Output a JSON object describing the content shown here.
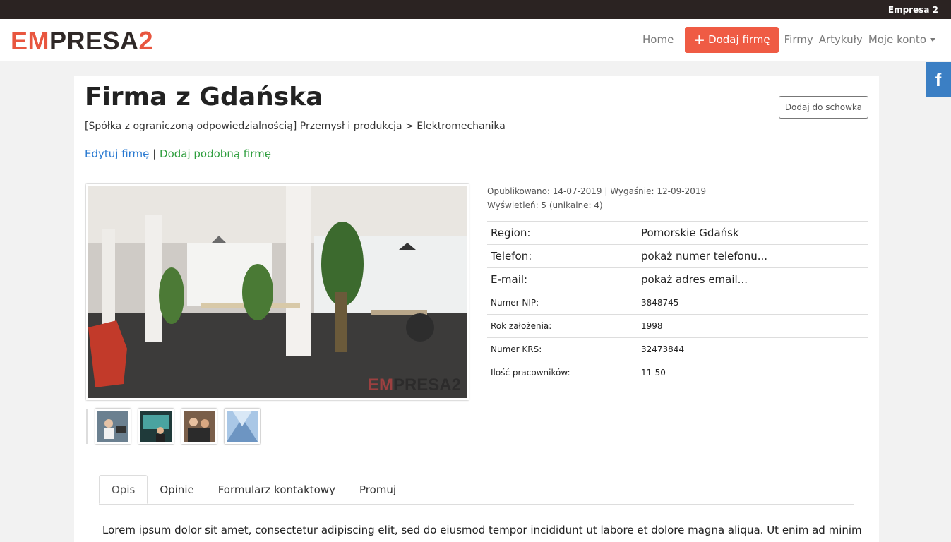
{
  "topbar": {
    "site_name": "Empresa 2"
  },
  "logo": {
    "part1": "EM",
    "part2": "PRESA",
    "part3": "2"
  },
  "nav": {
    "home": "Home",
    "add_company": "Dodaj firmę",
    "companies": "Firmy",
    "articles": "Artykuły",
    "account": "Moje konto"
  },
  "social": {
    "facebook": "f"
  },
  "company": {
    "title": "Firma z Gdańska",
    "save_button": "Dodaj do schowka",
    "subtitle": "[Spółka z ograniczoną odpowiedzialnością] Przemysł i produkcja > Elektromechanika",
    "edit_link": "Edytuj firmę",
    "separator": "|",
    "add_similar_link": "Dodaj podobną firmę",
    "published": "Opublikowano: 14-07-2019 | Wygaśnie: 12-09-2019",
    "views": "Wyświetleń: 5 (unikalne: 4)",
    "watermark": {
      "part1": "EM",
      "part2": "PRESA2"
    }
  },
  "details": [
    {
      "label": "Region:",
      "value": "Pomorskie Gdańsk"
    },
    {
      "label": "Telefon:",
      "value": "pokaż numer telefonu..."
    },
    {
      "label": "E-mail:",
      "value": "pokaż adres email..."
    },
    {
      "label": "Numer NIP:",
      "value": "3848745"
    },
    {
      "label": "Rok założenia:",
      "value": "1998"
    },
    {
      "label": "Numer KRS:",
      "value": "32473844"
    },
    {
      "label": "Ilość pracowników:",
      "value": "11-50"
    }
  ],
  "tabs": [
    "Opis",
    "Opinie",
    "Formularz kontaktowy",
    "Promuj"
  ],
  "description": "Lorem ipsum dolor sit amet, consectetur adipiscing elit, sed do eiusmod tempor incididunt ut labore et dolore magna aliqua. Ut enim ad minim",
  "colors": {
    "brand": "#ef5b44",
    "dark": "#2b2322",
    "link": "#2a7ad1",
    "green": "#2e9e3e",
    "facebook": "#3b7fc4"
  }
}
